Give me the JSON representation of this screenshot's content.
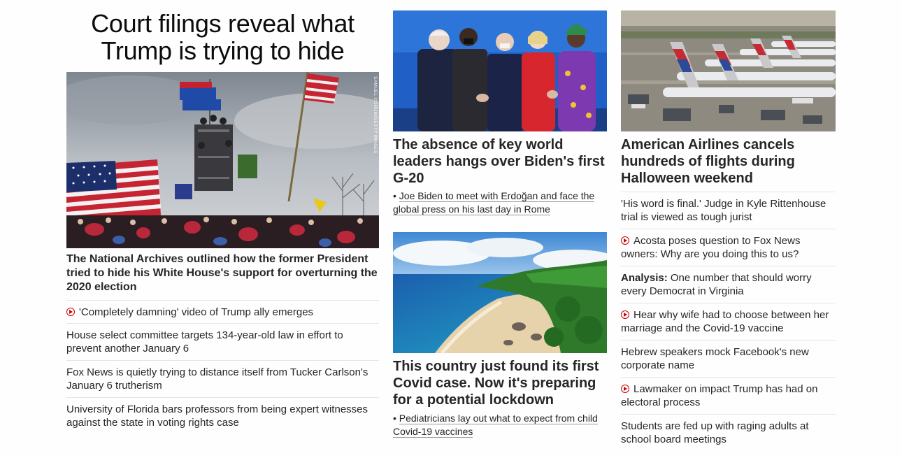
{
  "col1": {
    "headline": "Court filings reveal what Trump is trying to hide",
    "photo_credit": "SAMUEL CORUM/GETTY IMAGES",
    "caption": "The National Archives outlined how the former President tried to hide his White House's support for overturning the 2020 election",
    "links": [
      {
        "text": "'Completely damning' video of Trump ally emerges",
        "video": true
      },
      {
        "text": "House select committee targets 134-year-old law in effort to prevent another January 6",
        "video": false
      },
      {
        "text": "Fox News is quietly trying to distance itself from Tucker Carlson's January 6 trutherism",
        "video": false
      },
      {
        "text": "University of Florida bars professors from being expert witnesses against the state in voting rights case",
        "video": false
      }
    ]
  },
  "col2": {
    "g20_headline": "The absence of key world leaders hangs over Biden's first G-20",
    "g20_sub": "Joe Biden to meet with Erdoğan and face the global press on his last day in Rome",
    "island_headline": "This country just found its first Covid case. Now it's preparing for a potential lockdown",
    "island_sub": "Pediatricians lay out what to expect from child Covid-19 vaccines"
  },
  "col3": {
    "aa_headline": "American Airlines cancels hundreds of flights during Halloween weekend",
    "links": [
      {
        "prefix": "",
        "text": "'His word is final.' Judge in Kyle Rittenhouse trial is viewed as tough jurist",
        "video": false
      },
      {
        "prefix": "",
        "text": "Acosta poses question to Fox News owners: Why are you doing this to us?",
        "video": true
      },
      {
        "prefix": "Analysis:",
        "text": " One number that should worry every Democrat in Virginia",
        "video": false
      },
      {
        "prefix": "",
        "text": "Hear why wife had to choose between her marriage and the Covid-19 vaccine",
        "video": true
      },
      {
        "prefix": "",
        "text": "Hebrew speakers mock Facebook's new corporate name",
        "video": false
      },
      {
        "prefix": "",
        "text": "Lawmaker on impact Trump has had on electoral process",
        "video": true
      },
      {
        "prefix": "",
        "text": "Students are fed up with raging adults at school board meetings",
        "video": false
      }
    ]
  },
  "colors": {
    "text": "#262626",
    "video_accent": "#cc0000",
    "divider": "#e6e6e6"
  }
}
